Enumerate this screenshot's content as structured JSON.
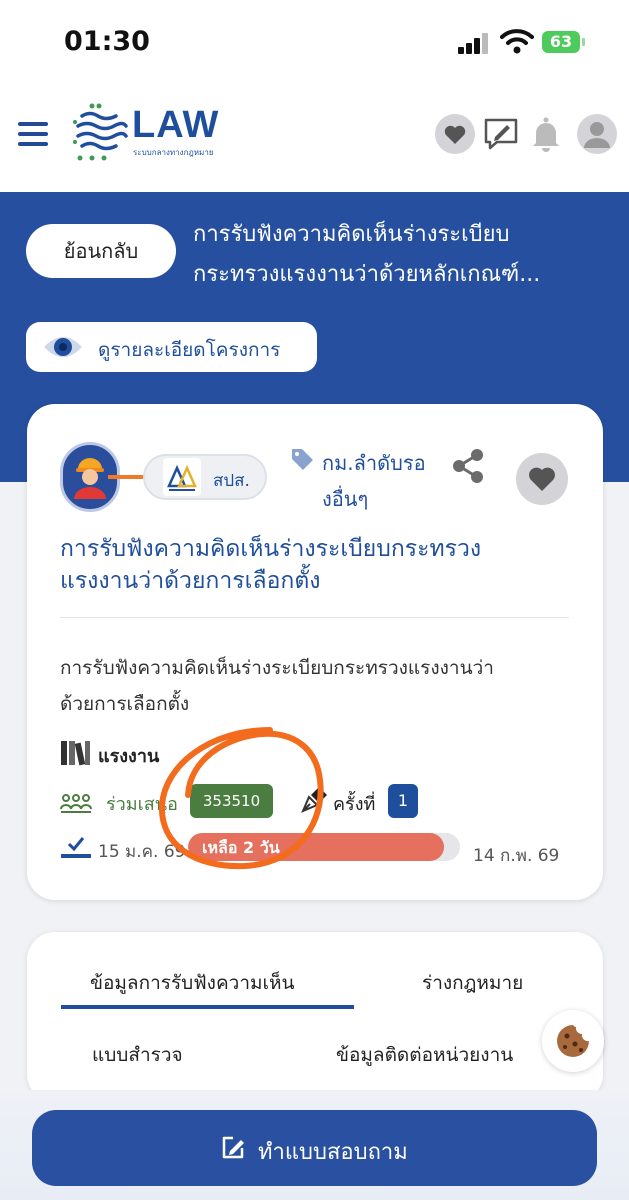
{
  "status_bar": {
    "time": "01:30",
    "battery": "63"
  },
  "header": {
    "logo_text": "LAW",
    "logo_subtitle": "ระบบกลางทางกฎหมาย",
    "icons": [
      "heart-icon",
      "edit-message-icon",
      "bell-icon",
      "user-icon"
    ]
  },
  "top": {
    "back_label": "ย้อนกลับ",
    "title_line1": "การรับฟังความคิดเห็นร่างระเบียบ",
    "title_line2": "กระทรวงแรงงานว่าด้วยหลักเกณฑ์...",
    "details_label": "ดูรายละเอียดโครงการ"
  },
  "card": {
    "org_short": "สปส.",
    "tag_line1": "กม.ลำดับรอ",
    "tag_line2": "งอื่นๆ",
    "title_line1": "การรับฟังความคิดเห็นร่างระเบียบกระทรวง",
    "title_line2": "แรงงานว่าด้วยการเลือกตั้ง",
    "desc_line1": "การรับฟังความคิดเห็นร่างระเบียบกระทรวงแรงงานว่า",
    "desc_line2": "ด้วยการเลือกตั้ง",
    "ministry": "แรงงาน",
    "join_label": "ร่วมเสนอ",
    "participant_count": "353510",
    "round_label": "ครั้งที่",
    "round_number": "1",
    "start_date": "15 ม.ค. 69",
    "remaining_label": "เหลือ 2 วัน",
    "remaining_fraction": 0.94,
    "end_date": "14 ก.พ. 69",
    "accent_green": "#4a7d3f",
    "accent_blue": "#1f4e9c",
    "progress_color": "#e4705d"
  },
  "tabs": [
    {
      "label": "ข้อมูลการรับฟังความเห็น",
      "active": true
    },
    {
      "label": "ร่างกฎหมาย",
      "active": false
    },
    {
      "label": "แบบสำรวจ",
      "active": false
    },
    {
      "label": "ข้อมูลติดต่อหน่วยงาน",
      "active": false
    }
  ],
  "bottom": {
    "survey_label": "ทำแบบสอบถาม"
  }
}
